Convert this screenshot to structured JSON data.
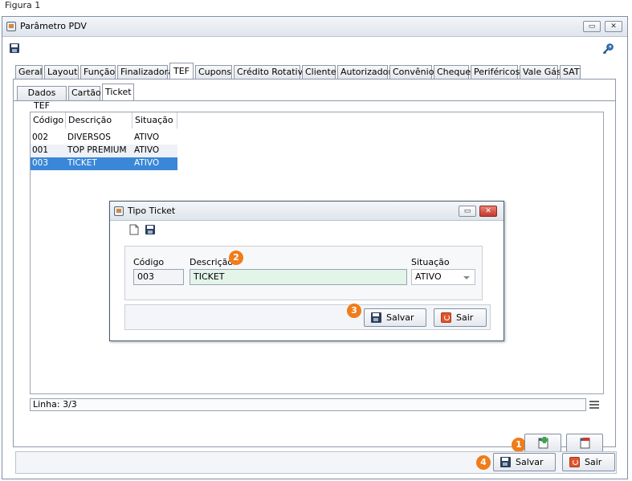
{
  "caption": "Figura 1",
  "window": {
    "title": "Parâmetro PDV",
    "restore_glyph": "▭",
    "close_glyph": "✕"
  },
  "tabs": [
    "Geral",
    "Layout",
    "Função",
    "Finalizadora",
    "TEF",
    "Cupons",
    "Crédito Rotativo",
    "Cliente",
    "Autorizador",
    "Convênio",
    "Cheque",
    "Periféricos",
    "Vale Gás",
    "SAT"
  ],
  "active_tab": "TEF",
  "subtabs": [
    "Dados TEF",
    "Cartão",
    "Ticket"
  ],
  "active_subtab": "Ticket",
  "grid": {
    "headers": [
      "Código",
      "Descrição",
      "Situação"
    ],
    "rows": [
      [
        "002",
        "DIVERSOS",
        "ATIVO"
      ],
      [
        "001",
        "TOP PREMIUM",
        "ATIVO"
      ],
      [
        "003",
        "TICKET",
        "ATIVO"
      ]
    ],
    "selected_row": 2
  },
  "status": "Linha: 3/3",
  "dialog": {
    "title": "Tipo Ticket",
    "codigo_label": "Código",
    "codigo_value": "003",
    "descricao_label": "Descrição",
    "descricao_value": "TICKET",
    "situacao_label": "Situação",
    "situacao_value": "ATIVO",
    "save_label": "Salvar",
    "exit_label": "Sair"
  },
  "footer": {
    "save_label": "Salvar",
    "exit_label": "Sair"
  },
  "badges": [
    "1",
    "2",
    "3",
    "4"
  ],
  "colors": {
    "badge": "#f07c1a",
    "selection": "#3a87d8",
    "exit_icon": "#e2542d"
  }
}
